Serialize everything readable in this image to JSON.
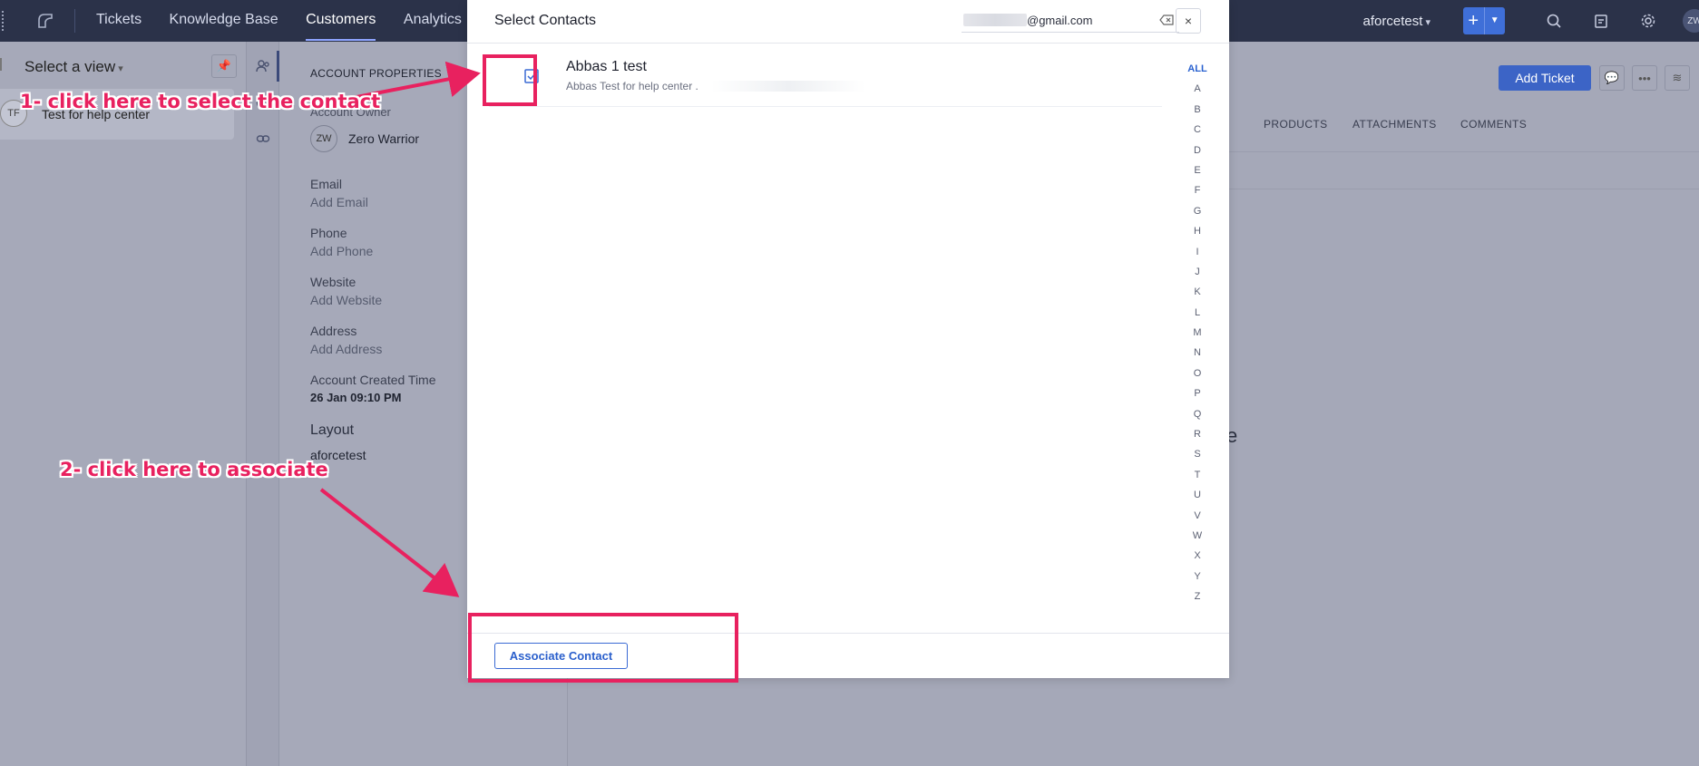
{
  "topbar": {
    "nav": [
      "Tickets",
      "Knowledge Base",
      "Customers",
      "Analytics",
      "A"
    ],
    "active_index": 2,
    "org": "aforcetest",
    "plus": "+",
    "avatar": "ZW"
  },
  "leftpanel": {
    "view_label": "Select a view",
    "item": {
      "avatar": "TF",
      "name": "Test for help center"
    }
  },
  "props": {
    "heading": "ACCOUNT PROPERTIES",
    "owner_label": "Account Owner",
    "owner_initials": "ZW",
    "owner_name": "Zero Warrior",
    "fields": [
      {
        "label": "Email",
        "value": "Add Email"
      },
      {
        "label": "Phone",
        "value": "Add Phone"
      },
      {
        "label": "Website",
        "value": "Add Website"
      },
      {
        "label": "Address",
        "value": "Add Address"
      },
      {
        "label": "Account Created Time",
        "value": "26 Jan 09:10 PM"
      }
    ],
    "layout_label": "Layout",
    "layout_value": "aforcetest"
  },
  "detail": {
    "add_ticket": "Add Ticket",
    "tabs": [
      "S",
      "PRODUCTS",
      "ATTACHMENTS",
      "COMMENTS"
    ],
    "ghost": "e"
  },
  "modal": {
    "title": "Select Contacts",
    "search_value": "@gmail.com",
    "close": "×",
    "contact": {
      "name": "Abbas 1 test",
      "sub": "Abbas Test for help center  ."
    },
    "alphabet": [
      "ALL",
      "A",
      "B",
      "C",
      "D",
      "E",
      "F",
      "G",
      "H",
      "I",
      "J",
      "K",
      "L",
      "M",
      "N",
      "O",
      "P",
      "Q",
      "R",
      "S",
      "T",
      "U",
      "V",
      "W",
      "X",
      "Y",
      "Z"
    ],
    "alphabet_selected": "ALL",
    "associate_button": "Associate Contact"
  },
  "annotations": {
    "step1": "1- click here to select the contact",
    "step2": "2- click here to associate",
    "color": "#e8215f"
  }
}
